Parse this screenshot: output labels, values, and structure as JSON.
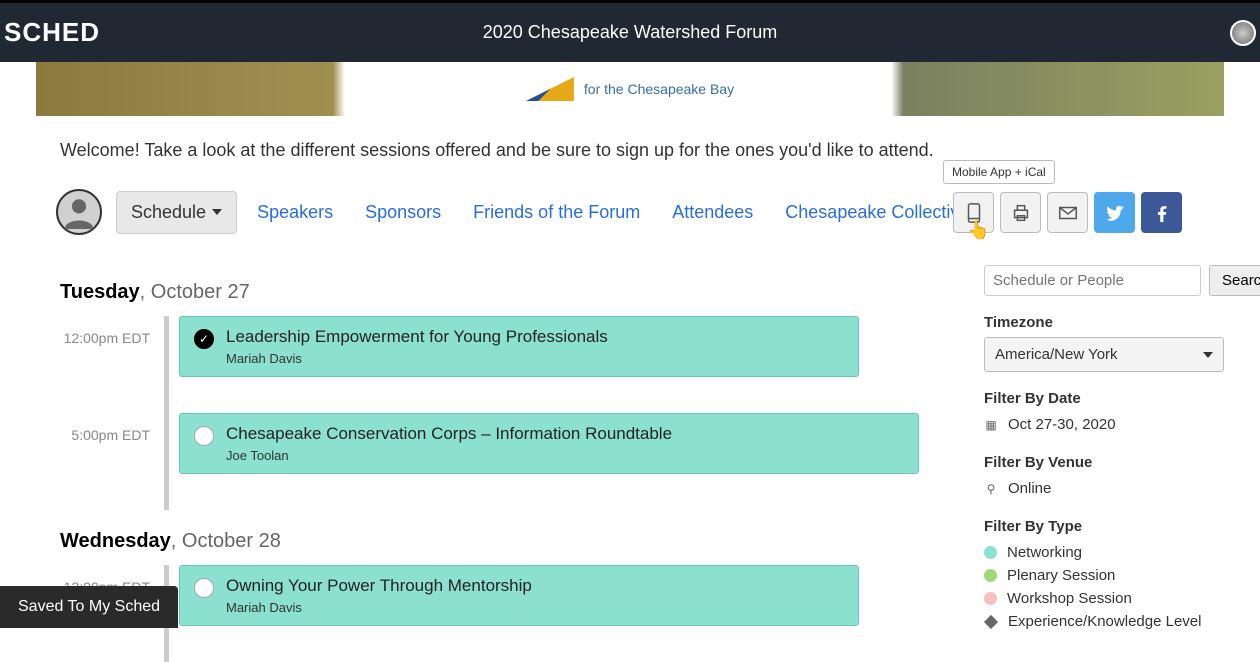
{
  "topbar": {
    "logo": "SCHED",
    "title": "2020 Chesapeake Watershed Forum"
  },
  "banner": {
    "text": "for the Chesapeake Bay"
  },
  "welcome": "Welcome! Take a look at the different sessions offered and be sure to sign up for the ones you'd like to attend.",
  "nav": {
    "schedule": "Schedule",
    "links": [
      "Speakers",
      "Sponsors",
      "Friends of the Forum",
      "Attendees",
      "Chesapeake Collective"
    ]
  },
  "toolbar": {
    "tooltip": "Mobile App + iCal"
  },
  "schedule": [
    {
      "day_bold": "Tuesday",
      "day_rest": ", October 27",
      "slots": [
        {
          "time": "12:00pm EDT",
          "sessions": [
            {
              "title": "Leadership Empowerment for Young Professionals",
              "speaker": "Mariah Davis",
              "checked": true
            }
          ]
        },
        {
          "time": "5:00pm EDT",
          "sessions": [
            {
              "title": "Chesapeake Conservation Corps – Information Roundtable",
              "speaker": "Joe Toolan",
              "checked": false,
              "wide": true
            }
          ]
        }
      ]
    },
    {
      "day_bold": "Wednesday",
      "day_rest": ", October 28",
      "slots": [
        {
          "time": "12:00pm EDT",
          "sessions": [
            {
              "title": "Owning Your Power Through Mentorship",
              "speaker": "Mariah Davis",
              "checked": false
            }
          ]
        }
      ]
    }
  ],
  "sidebar": {
    "search_placeholder": "Schedule or People",
    "search_btn": "Search",
    "tz_heading": "Timezone",
    "tz_value": "America/New York",
    "date_heading": "Filter By Date",
    "date_value": "Oct 27-30, 2020",
    "venue_heading": "Filter By Venue",
    "venue_value": "Online",
    "type_heading": "Filter By Type",
    "types": [
      {
        "label": "Networking",
        "color": "teal"
      },
      {
        "label": "Plenary Session",
        "color": "green"
      },
      {
        "label": "Workshop Session",
        "color": "pink"
      },
      {
        "label": "Experience/Knowledge Level",
        "color": "diamond"
      }
    ]
  },
  "toast": "Saved To My Sched"
}
